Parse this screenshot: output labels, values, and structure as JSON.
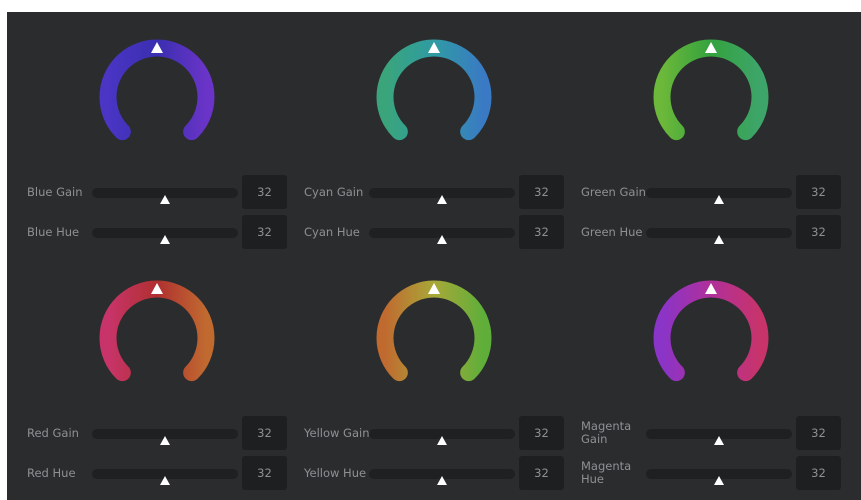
{
  "groups": [
    {
      "id": "blue",
      "gradient": [
        "#4a35c4",
        "#3a2fb0",
        "#6a34c8"
      ],
      "controls": [
        {
          "label": "Blue Gain",
          "value": "32",
          "level": 0.5
        },
        {
          "label": "Blue Hue",
          "value": "32",
          "level": 0.5
        }
      ]
    },
    {
      "id": "cyan",
      "gradient": [
        "#3aa57a",
        "#2f9ba3",
        "#3a7ac4"
      ],
      "controls": [
        {
          "label": "Cyan Gain",
          "value": "32",
          "level": 0.5
        },
        {
          "label": "Cyan Hue",
          "value": "32",
          "level": 0.5
        }
      ]
    },
    {
      "id": "green",
      "gradient": [
        "#6cb83a",
        "#34a23e",
        "#3ea56a"
      ],
      "controls": [
        {
          "label": "Green Gain",
          "value": "32",
          "level": 0.5
        },
        {
          "label": "Green Hue",
          "value": "32",
          "level": 0.5
        }
      ]
    },
    {
      "id": "red",
      "gradient": [
        "#c8346a",
        "#b03030",
        "#c06a30"
      ],
      "controls": [
        {
          "label": "Red Gain",
          "value": "32",
          "level": 0.5
        },
        {
          "label": "Red Hue",
          "value": "32",
          "level": 0.5
        }
      ]
    },
    {
      "id": "yellow",
      "gradient": [
        "#c06a30",
        "#a8a838",
        "#5fae3a"
      ],
      "controls": [
        {
          "label": "Yellow Gain",
          "value": "32",
          "level": 0.5
        },
        {
          "label": "Yellow Hue",
          "value": "32",
          "level": 0.5
        }
      ]
    },
    {
      "id": "magenta",
      "gradient": [
        "#8a34c8",
        "#b0309a",
        "#c8346a"
      ],
      "controls": [
        {
          "label": "Magenta Gain",
          "value": "32",
          "level": 0.5
        },
        {
          "label": "Magenta Hue",
          "value": "32",
          "level": 0.5
        }
      ]
    }
  ],
  "colors": {
    "panel": "#2b2c2e",
    "track": "#1f2022",
    "value_box": "#1e1f21",
    "label_text": "#8f9094",
    "indicator": "#ffffff"
  }
}
